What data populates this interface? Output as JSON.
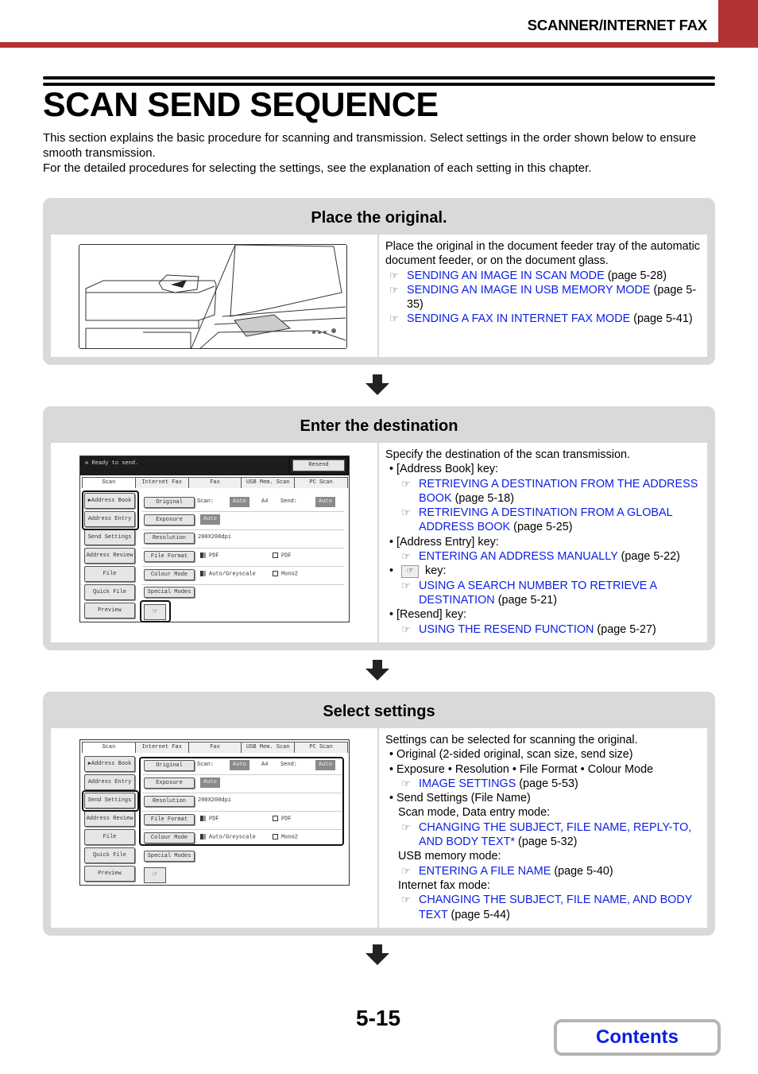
{
  "header": {
    "section": "SCANNER/INTERNET FAX",
    "accent_color": "#b33232"
  },
  "page": {
    "title": "SCAN SEND SEQUENCE",
    "intro_1": "This section explains the basic procedure for scanning and transmission. Select settings in the order shown below to ensure smooth transmission.",
    "intro_2": "For the detailed procedures for selecting the settings, see the explanation of each setting in this chapter.",
    "page_number": "5-15",
    "contents_label": "Contents",
    "link_color": "#0a1ee6"
  },
  "steps": [
    {
      "title": "Place the original.",
      "text": "Place the original in the document feeder tray of the automatic document feeder, or on the document glass.",
      "refs": [
        {
          "link": "SENDING AN IMAGE IN SCAN MODE",
          "page": "(page 5-28)"
        },
        {
          "link": "SENDING AN IMAGE IN USB MEMORY MODE",
          "page": "(page 5-35)"
        },
        {
          "link": "SENDING A FAX IN INTERNET FAX MODE",
          "page": "(page 5-41)"
        }
      ]
    },
    {
      "title": "Enter the destination",
      "text": "Specify the destination of the scan transmission.",
      "bullet_address_book": "• [Address Book] key:",
      "ref_ab1": {
        "link": "RETRIEVING A DESTINATION FROM THE ADDRESS BOOK",
        "page": "(page 5-18)"
      },
      "ref_ab2": {
        "link": "RETRIEVING A DESTINATION FROM A GLOBAL ADDRESS BOOK",
        "page": "(page 5-25)"
      },
      "bullet_address_entry": "• [Address Entry] key:",
      "ref_ae": {
        "link": "ENTERING AN ADDRESS MANUALLY",
        "page": "(page 5-22)"
      },
      "bullet_search_key": "key:",
      "ref_search": {
        "link": "USING A SEARCH NUMBER TO RETRIEVE A DESTINATION",
        "page": "(page 5-21)"
      },
      "bullet_resend": "• [Resend] key:",
      "ref_resend": {
        "link": "USING THE RESEND FUNCTION",
        "page": "(page 5-27)"
      }
    },
    {
      "title": "Select settings",
      "text": "Settings can be selected for scanning the original.",
      "bullet_original": "• Original (2-sided original, scan size, send size)",
      "bullet_image": "• Exposure  • Resolution  • File Format  • Colour Mode",
      "ref_image": {
        "link": "IMAGE SETTINGS",
        "page": "(page 5-53)"
      },
      "bullet_send": "• Send Settings (File Name)",
      "scan_mode": "Scan mode, Data entry mode:",
      "ref_scan": {
        "link": "CHANGING THE SUBJECT, FILE NAME, REPLY-TO, AND BODY TEXT*",
        "page": "(page 5-32)"
      },
      "usb_mode": "USB memory mode:",
      "ref_usb": {
        "link": "ENTERING A FILE NAME",
        "page": "(page 5-40)"
      },
      "ifax_mode": "Internet fax mode:",
      "ref_ifax": {
        "link": "CHANGING THE SUBJECT, FILE NAME, AND BODY TEXT",
        "page": "(page 5-44)"
      }
    }
  ],
  "panel": {
    "status": "Ready to send.",
    "resend": "Resend",
    "tabs": [
      "Scan",
      "Internet Fax",
      "Fax",
      "USB Mem. Scan",
      "PC Scan"
    ],
    "left_buttons": [
      "▶Address Book",
      "Address Entry",
      "Send Settings",
      "Address Review",
      "File",
      "Quick File",
      "Preview"
    ],
    "settings": [
      "Original",
      "Exposure",
      "Resolution",
      "File Format",
      "Colour Mode",
      "Special Modes"
    ],
    "scan_label": "Scan:",
    "scan_value": "Auto",
    "paper_size": "A4",
    "send_label": "Send:",
    "send_value": "Auto",
    "exposure_value": "Auto",
    "resolution_value": "200X200dpi",
    "format_color": "PDF",
    "format_mono": "PDF",
    "mode_color": "Auto/Greyscale",
    "mode_mono": "Mono2"
  }
}
